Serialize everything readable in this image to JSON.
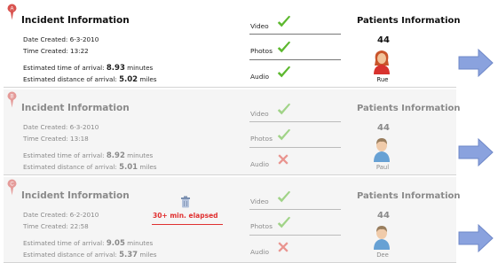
{
  "incidents": [
    {
      "title": "Incident Information",
      "pin_letter": "A",
      "date_label": "Date Created:",
      "date": "6-3-2010",
      "time_label": "Time Created:",
      "time": "13:22",
      "eta_label": "Estimated time of arrival:",
      "eta_value": "8.93",
      "eta_unit": "minutes",
      "dist_label": "Estimated distance of arrival:",
      "dist_value": "5.02",
      "dist_unit": "miles",
      "elapsed": "",
      "media": [
        {
          "label": "Video",
          "status": "available"
        },
        {
          "label": "Photos",
          "status": "available"
        },
        {
          "label": "Audio",
          "status": "available"
        }
      ],
      "patients_title": "Patients Information",
      "patient_count": "44",
      "patient_name": "Rue",
      "patient_avatar": "female-patient-avatar"
    },
    {
      "title": "Incident Information",
      "pin_letter": "B",
      "date_label": "Date Created:",
      "date": "6-3-2010",
      "time_label": "Time Created:",
      "time": "13:18",
      "eta_label": "Estimated time of arrival:",
      "eta_value": "8.92",
      "eta_unit": "minutes",
      "dist_label": "Estimated distance of arrival:",
      "dist_value": "5.01",
      "dist_unit": "miles",
      "elapsed": "",
      "media": [
        {
          "label": "Video",
          "status": "available"
        },
        {
          "label": "Photos",
          "status": "available"
        },
        {
          "label": "Audio",
          "status": "unavailable"
        }
      ],
      "patients_title": "Patients Information",
      "patient_count": "44",
      "patient_name": "Paul",
      "patient_avatar": "male-patient-avatar"
    },
    {
      "title": "Incident Information",
      "pin_letter": "C",
      "date_label": "Date Created:",
      "date": "6-2-2010",
      "time_label": "Time Created:",
      "time": "22:58",
      "eta_label": "Estimated time of arrival:",
      "eta_value": "9.05",
      "eta_unit": "minutes",
      "dist_label": "Estimated distance of arrival:",
      "dist_value": "5.37",
      "dist_unit": "miles",
      "elapsed": "30+ min. elapsed",
      "media": [
        {
          "label": "Video",
          "status": "available"
        },
        {
          "label": "Photos",
          "status": "available"
        },
        {
          "label": "Audio",
          "status": "unavailable"
        }
      ],
      "patients_title": "Patients Information",
      "patient_count": "44",
      "patient_name": "Dee",
      "patient_avatar": "male-patient-avatar"
    }
  ],
  "colors": {
    "check": "#5cb82e",
    "cross": "#e0463c",
    "pin": "#d9534f",
    "arrow": "#8aa2de",
    "elapsed": "#e03030"
  },
  "icons": [
    "map-pin-icon",
    "check-icon",
    "cross-icon",
    "trash-icon",
    "forward-arrow-icon"
  ]
}
